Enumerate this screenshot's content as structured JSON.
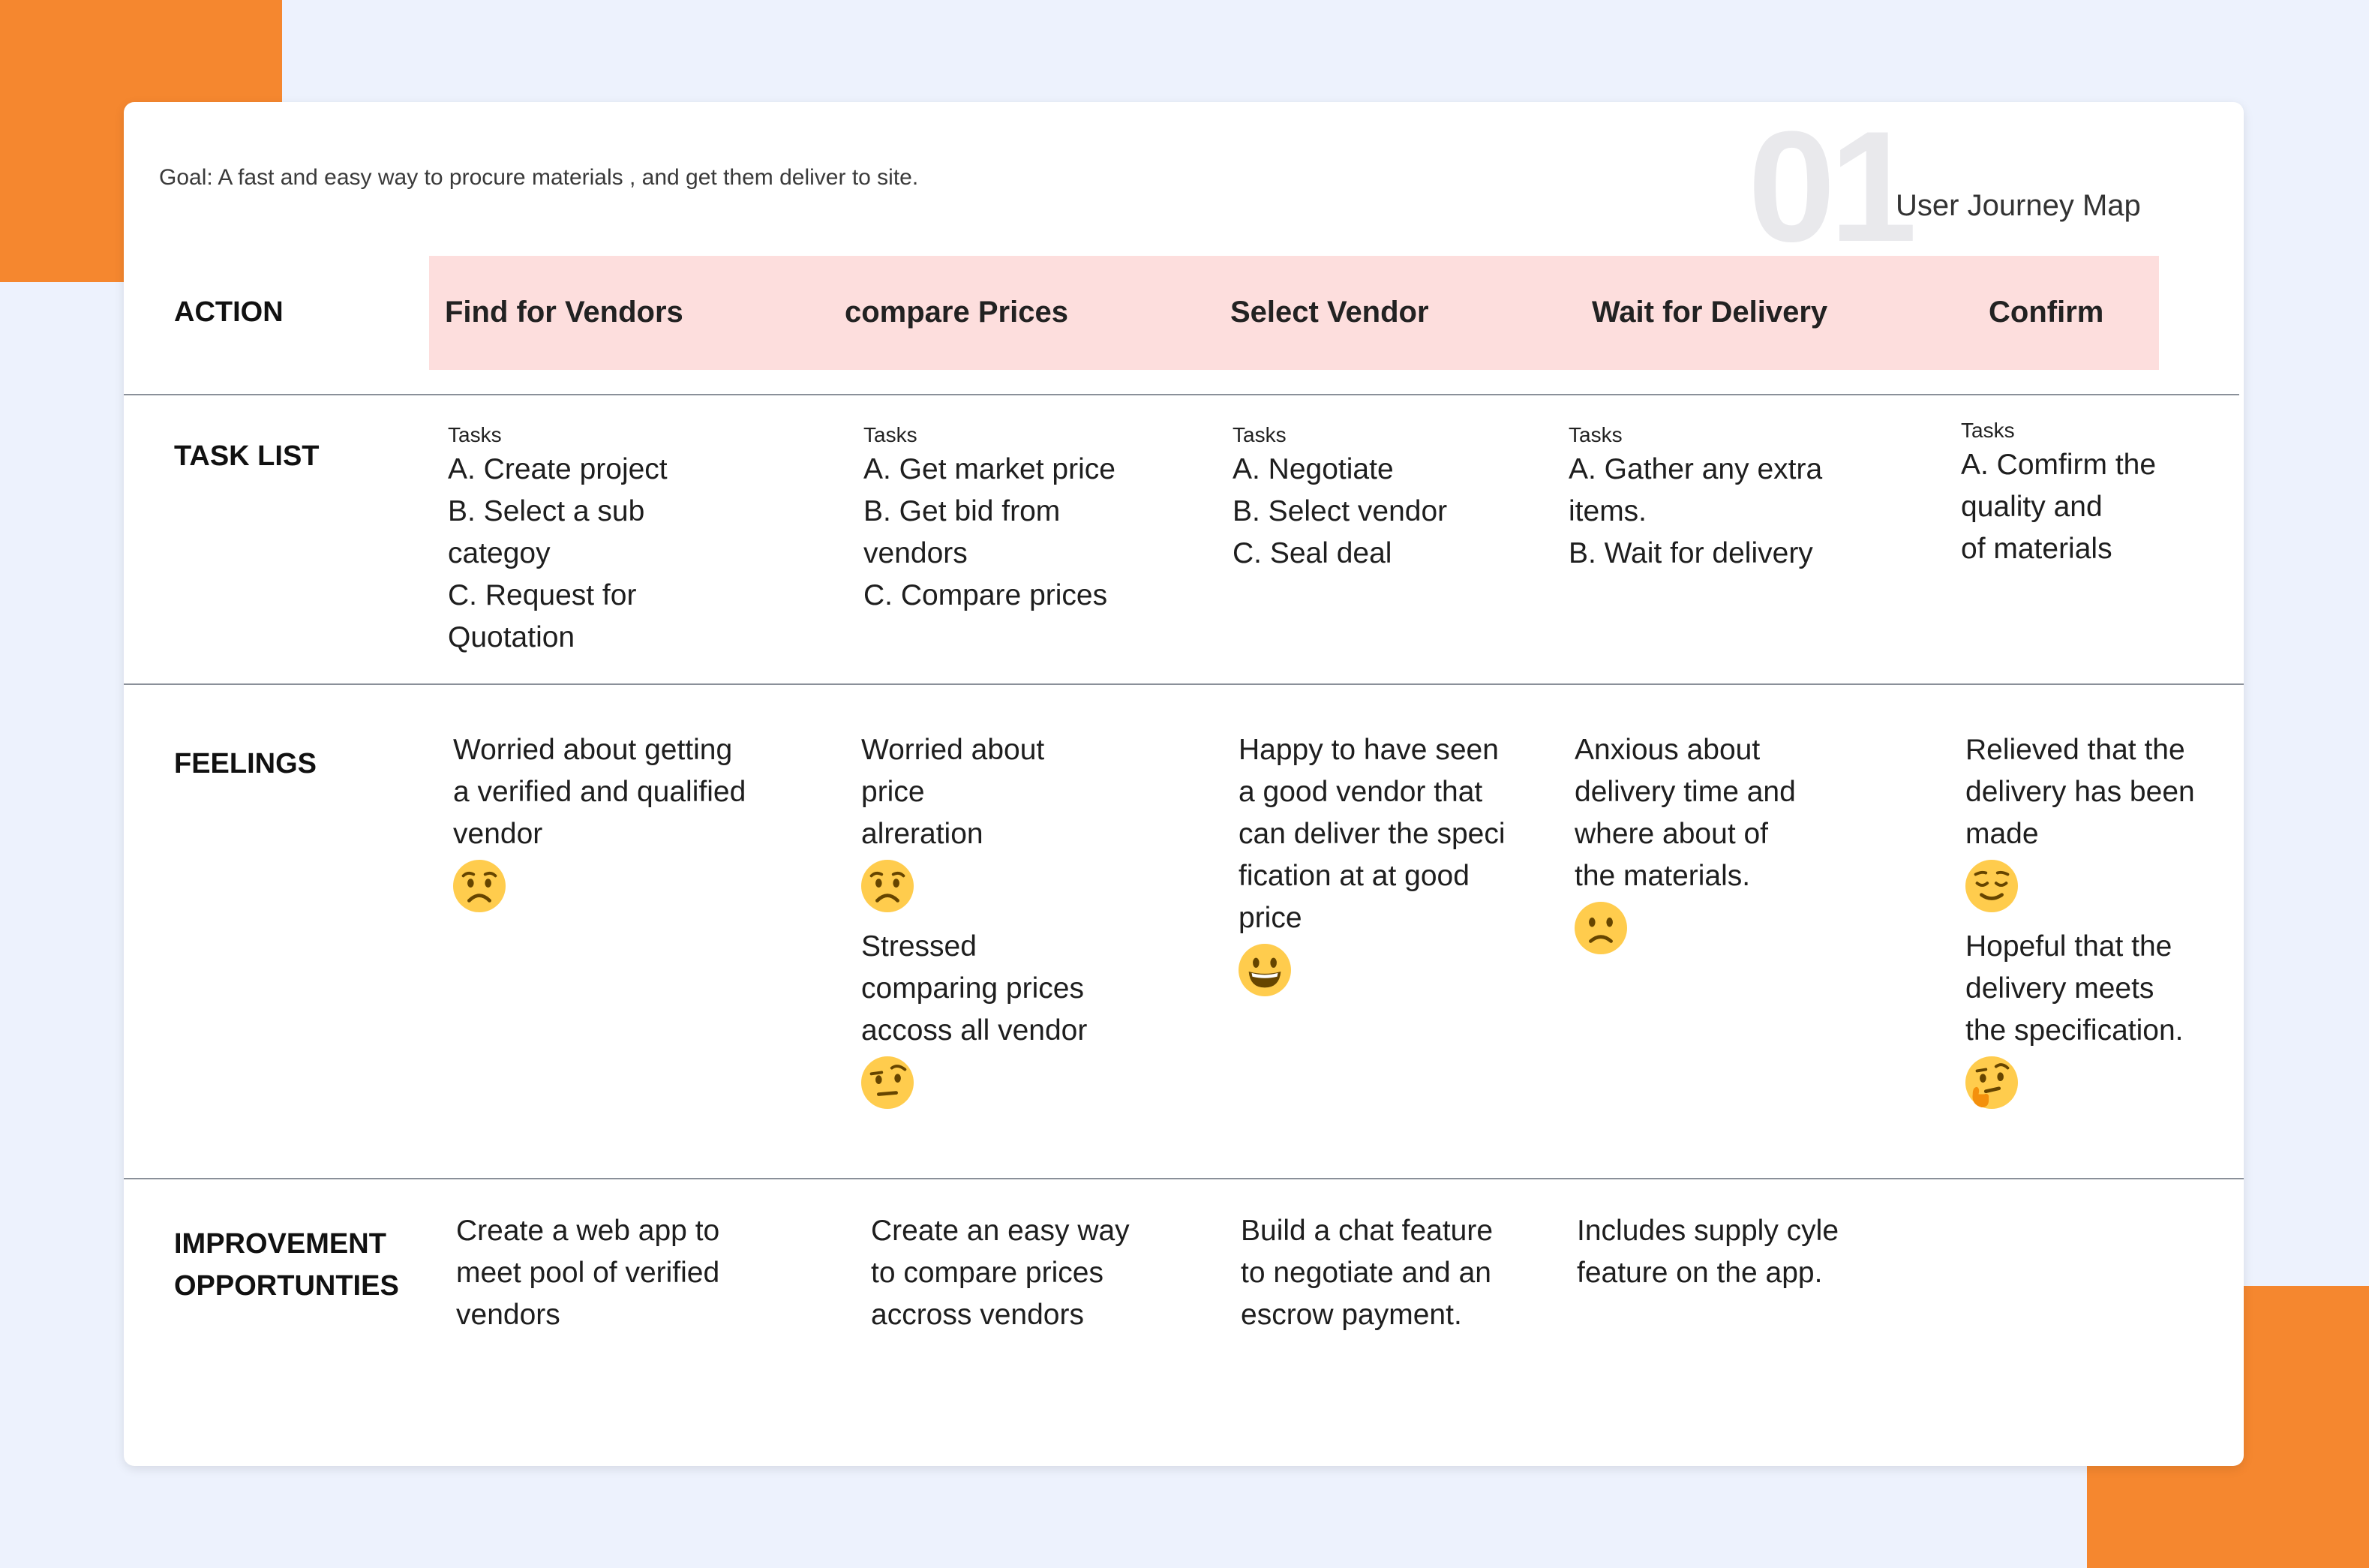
{
  "goal": "Goal: A fast and easy way to procure materials , and get them deliver to site.",
  "map_number": "01",
  "map_title": "User Journey Map",
  "rows": {
    "action": "ACTION",
    "task_list": "TASK LIST",
    "feelings": "FEELINGS",
    "improvement_1": "IMPROVEMENT",
    "improvement_2": "OPPORTUNTIES"
  },
  "actions": [
    "Find for Vendors",
    "compare Prices",
    "Select Vendor",
    "Wait for Delivery",
    "Confirm"
  ],
  "tasks_heading": "Tasks",
  "tasks": [
    [
      "A. Create project",
      "B. Select a sub",
      "categoy",
      "C. Request for",
      "Quotation"
    ],
    [
      "A. Get market price",
      "B. Get bid from",
      "vendors",
      "C. Compare prices"
    ],
    [
      "A. Negotiate",
      "B. Select vendor",
      "C. Seal deal"
    ],
    [
      "A. Gather any extra",
      "items.",
      "B. Wait for delivery"
    ],
    [
      "A. Comfirm the",
      "quality and",
      "of materials"
    ]
  ],
  "feelings": [
    [
      {
        "lines": [
          "Worried about getting",
          "a verified and qualified",
          "vendor"
        ],
        "emoji": "worried-face-icon"
      }
    ],
    [
      {
        "lines": [
          "Worried about",
          "price",
          "alreration"
        ],
        "emoji": "worried-face-icon"
      },
      {
        "lines": [
          "Stressed",
          "comparing prices",
          "accoss all vendor"
        ],
        "emoji": "face-with-raised-eyebrow-icon"
      }
    ],
    [
      {
        "lines": [
          "Happy to have seen",
          "a good vendor that",
          "can deliver the speci",
          "fication at at good",
          "price"
        ],
        "emoji": "grinning-face-icon"
      }
    ],
    [
      {
        "lines": [
          "Anxious about",
          "delivery time and",
          "where about of",
          "the materials."
        ],
        "emoji": "slightly-frowning-face-icon"
      }
    ],
    [
      {
        "lines": [
          "Relieved that the",
          "delivery has been",
          "made"
        ],
        "emoji": "relieved-face-icon"
      },
      {
        "lines": [
          "Hopeful that the",
          "delivery meets",
          "the specification."
        ],
        "emoji": "thinking-face-icon"
      }
    ]
  ],
  "improvements": [
    [
      "Create a web app to",
      "meet pool of verified",
      "vendors"
    ],
    [
      "Create an easy way",
      "to compare prices",
      "accross vendors"
    ],
    [
      "Build a chat feature",
      "to  negotiate and an",
      "escrow payment."
    ],
    [
      "Includes supply cyle",
      "feature on the app."
    ]
  ],
  "colors": {
    "background": "#EDF2FD",
    "accent_orange": "#F5872F",
    "action_band": "#FDDEDD",
    "emoji_yellow": "#FFCC4D"
  }
}
